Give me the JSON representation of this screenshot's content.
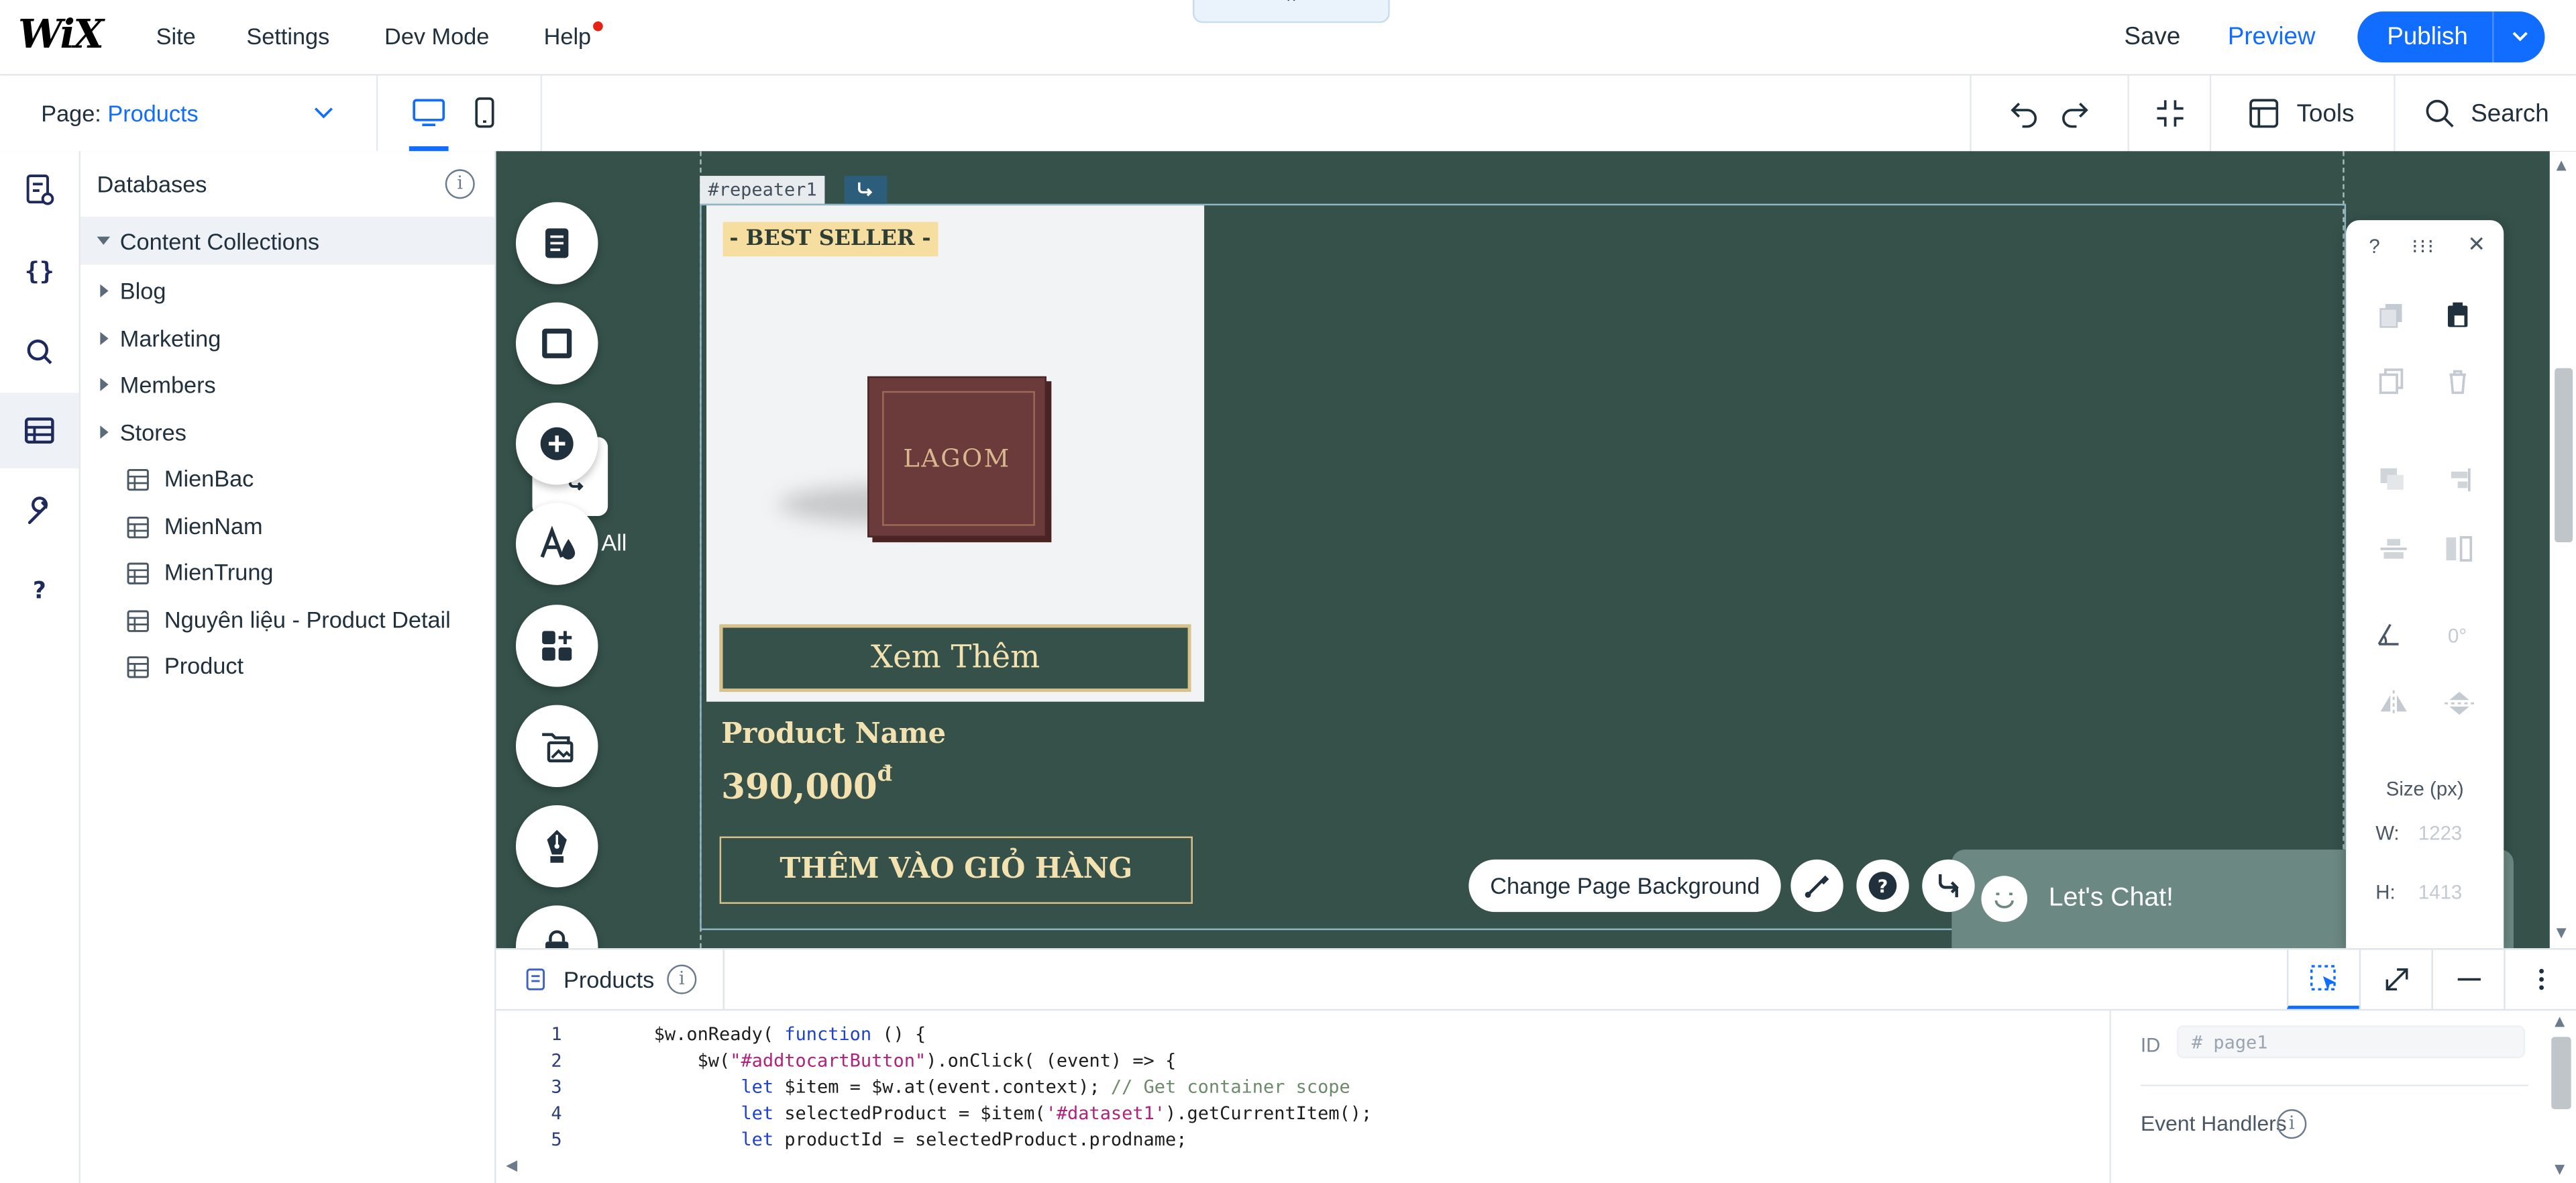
{
  "topbar": {
    "logo": "WiX",
    "menu": [
      "Site",
      "Settings",
      "Dev Mode",
      "Help"
    ],
    "save": "Save",
    "preview": "Preview",
    "publish": "Publish"
  },
  "subbar": {
    "page_label": "Page:",
    "page_value": "Products",
    "tools": "Tools",
    "search": "Search"
  },
  "databases": {
    "title": "Databases",
    "section": "Content Collections",
    "folders": [
      "Blog",
      "Marketing",
      "Members",
      "Stores"
    ],
    "collections": [
      "MienBac",
      "MienNam",
      "MienTrung",
      "Nguyên liệu - Product Detail",
      "Product"
    ]
  },
  "canvas": {
    "repeater_tag": "#repeater1",
    "best_seller": "- BEST SELLER -",
    "xem_them": "Xem Thêm",
    "product_name": "Product Name",
    "price": "390,000",
    "currency": "đ",
    "add_to_cart": "THÊM VÀO GIỎ HÀNG",
    "all_label": "All",
    "change_bg": "Change Page Background",
    "chat": "Let's Chat!",
    "colors": {
      "background": "#35514a",
      "gold": "#f3e2b0",
      "accent": "#116dff"
    }
  },
  "inspector": {
    "help": "?",
    "rotation": "0°",
    "size_label": "Size (px)",
    "w_label": "W:",
    "w_value": "1223",
    "h_label": "H:",
    "h_value": "1413"
  },
  "code_panel": {
    "tab": "Products",
    "id_label": "ID",
    "id_value": "# page1",
    "event_handlers": "Event Handlers"
  }
}
